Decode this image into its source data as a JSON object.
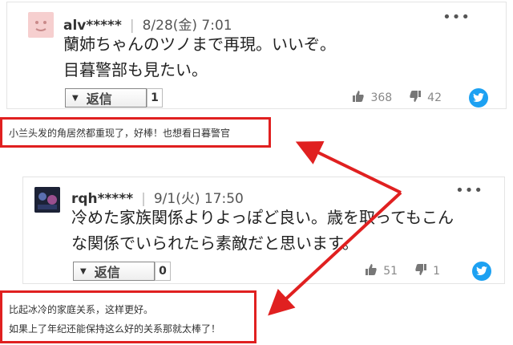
{
  "comments": [
    {
      "username": "alv*****",
      "date": "8/28(金) 7:01",
      "more": "•••",
      "lines": [
        "蘭姉ちゃんのツノまで再現。いいぞ。",
        "目暮警部も見たい。"
      ],
      "reply_label": "返信",
      "reply_count": "1",
      "likes": "368",
      "dislikes": "42"
    },
    {
      "username": "rqh*****",
      "date": "9/1(火) 17:50",
      "more": "•••",
      "lines": [
        "冷めた家族関係よりよっぽど良い。歳を取ってもこん",
        "な関係でいられたら素敵だと思います。"
      ],
      "reply_label": "返信",
      "reply_count": "0",
      "likes": "51",
      "dislikes": "1"
    }
  ],
  "translations": [
    {
      "lines": [
        "小兰头发的角居然都重现了，好棒！也想看日暮警官"
      ]
    },
    {
      "lines": [
        "比起冰冷的家庭关系，这样更好。",
        "如果上了年纪还能保持这么好的关系那就太棒了！"
      ]
    }
  ],
  "icons": {
    "thumb_up": "thumbs-up-icon",
    "thumb_down": "thumbs-down-icon",
    "twitter": "twitter-icon",
    "caret": "caret-down-icon",
    "more": "more-horizontal-icon"
  },
  "colors": {
    "annotation_red": "#e02020",
    "twitter_blue": "#1da1f2"
  }
}
